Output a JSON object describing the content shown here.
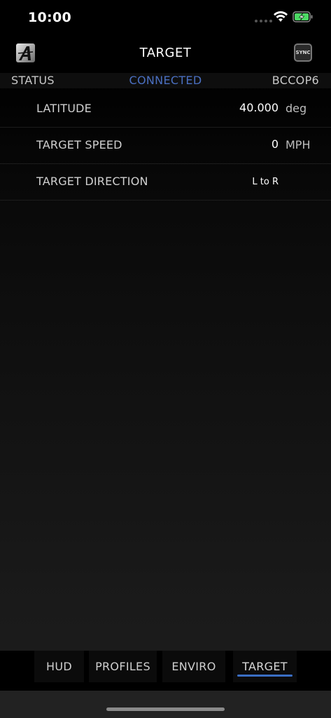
{
  "status_bar": {
    "time": "10:00"
  },
  "nav": {
    "title": "TARGET",
    "sync_label": "SYNC"
  },
  "connection": {
    "label": "STATUS",
    "value": "CONNECTED",
    "device": "BCCOP6"
  },
  "settings": [
    {
      "label": "LATITUDE",
      "value": "40.000",
      "unit": "deg"
    },
    {
      "label": "TARGET SPEED",
      "value": "0",
      "unit": "MPH"
    },
    {
      "label": "TARGET DIRECTION",
      "value": "L to R",
      "unit": ""
    }
  ],
  "tabs": [
    {
      "label": "HUD"
    },
    {
      "label": "PROFILES"
    },
    {
      "label": "ENVIRO"
    },
    {
      "label": "TARGET"
    }
  ],
  "colors": {
    "accent": "#3a6ec4",
    "connected": "#4a6fc0",
    "battery": "#4cd964"
  }
}
